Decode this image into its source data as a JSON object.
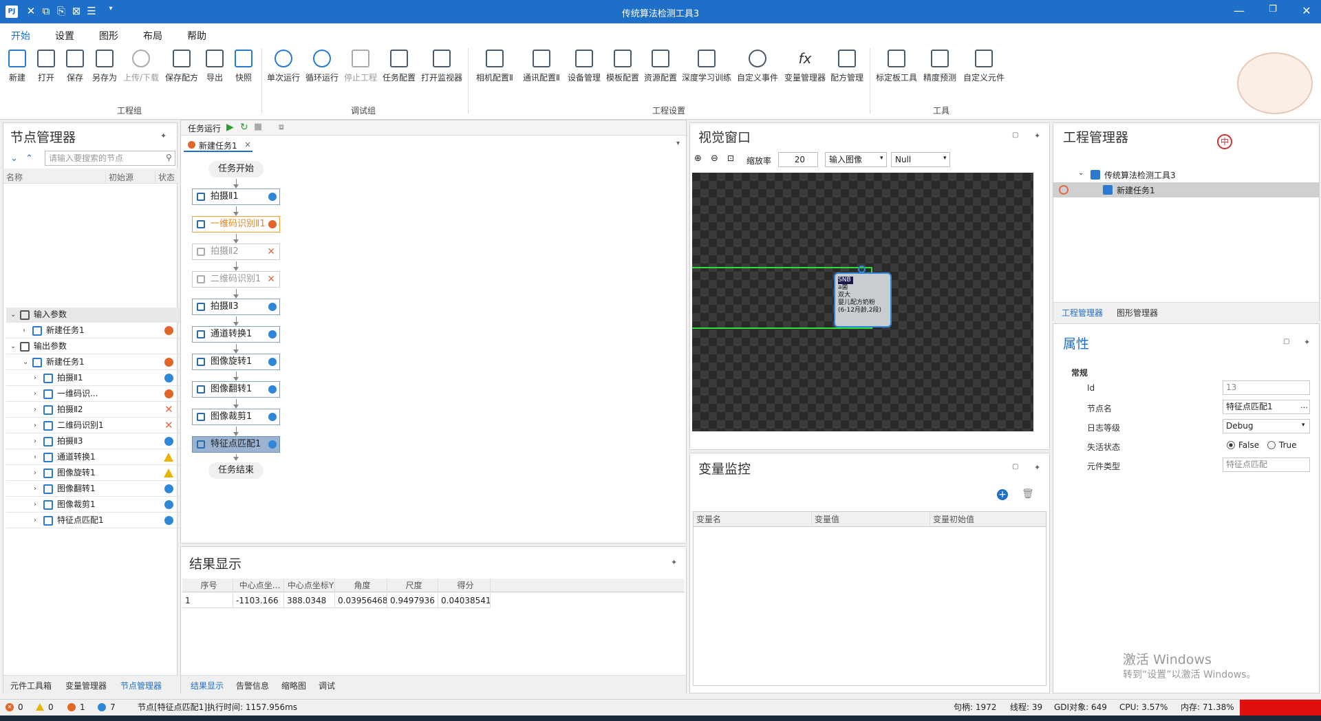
{
  "window": {
    "title": "传统算法检测工具3",
    "app_icon": "PJ"
  },
  "menu": {
    "items": [
      "开始",
      "设置",
      "图形",
      "布局",
      "帮助"
    ]
  },
  "ribbon": {
    "file_buttons": [
      "新建",
      "打开",
      "保存",
      "另存为",
      "上传/下载",
      "保存配方",
      "导出",
      "快照"
    ],
    "file_group": "工程组",
    "debug_buttons": [
      "单次运行",
      "循环运行",
      "停止工程",
      "任务配置",
      "打开监视器"
    ],
    "debug_group": "调试组",
    "settings_buttons": [
      "相机配置Ⅱ",
      "通讯配置Ⅱ",
      "设备管理",
      "模板配置",
      "资源配置",
      "深度学习训练",
      "自定义事件",
      "变量管理器",
      "配方管理"
    ],
    "settings_group": "工程设置",
    "tool_buttons": [
      "标定板工具",
      "精度预测",
      "自定义元件"
    ],
    "tool_group": "工具"
  },
  "node_manager": {
    "title": "节点管理器",
    "search_placeholder": "请输入要搜索的节点",
    "columns": [
      "名称",
      "初始源",
      "状态"
    ],
    "rows": [
      {
        "label": "输入参数",
        "level": 0,
        "group": true,
        "status": ""
      },
      {
        "label": "新建任务1",
        "level": 1,
        "status": "orange"
      },
      {
        "label": "输出参数",
        "level": 0,
        "group": false,
        "status": ""
      },
      {
        "label": "新建任务1",
        "level": 1,
        "status": "orange"
      },
      {
        "label": "拍摄Ⅱ1",
        "level": 2,
        "status": "blue"
      },
      {
        "label": "一维码识...",
        "level": 2,
        "status": "orange"
      },
      {
        "label": "拍摄Ⅱ2",
        "level": 2,
        "status": "x"
      },
      {
        "label": "二维码识别1",
        "level": 2,
        "status": "x"
      },
      {
        "label": "拍摄Ⅱ3",
        "level": 2,
        "status": "blue"
      },
      {
        "label": "通道转换1",
        "level": 2,
        "status": "warn"
      },
      {
        "label": "图像旋转1",
        "level": 2,
        "status": "warn"
      },
      {
        "label": "图像翻转1",
        "level": 2,
        "status": "blue"
      },
      {
        "label": "图像裁剪1",
        "level": 2,
        "status": "blue"
      },
      {
        "label": "特征点匹配1",
        "level": 2,
        "status": "blue"
      }
    ],
    "bottom_tabs": [
      "元件工具箱",
      "变量管理器",
      "节点管理器"
    ]
  },
  "task": {
    "run_label": "任务运行",
    "tab_name": "新建任务1",
    "start": "任务开始",
    "end": "任务结束",
    "nodes": [
      {
        "label": "拍摄Ⅱ1",
        "state": "normal",
        "dot": "blue"
      },
      {
        "label": "一维码识别Ⅱ1",
        "state": "warnb",
        "dot": "orange"
      },
      {
        "label": "拍摄Ⅱ2",
        "state": "disabled",
        "dot": "x"
      },
      {
        "label": "二维码识别1",
        "state": "disabled",
        "dot": "x"
      },
      {
        "label": "拍摄Ⅱ3",
        "state": "normal",
        "dot": "blue"
      },
      {
        "label": "通道转换1",
        "state": "normal",
        "dot": "blue"
      },
      {
        "label": "图像旋转1",
        "state": "normal",
        "dot": "blue"
      },
      {
        "label": "图像翻转1",
        "state": "normal",
        "dot": "blue"
      },
      {
        "label": "图像裁剪1",
        "state": "normal",
        "dot": "blue"
      },
      {
        "label": "特征点匹配1",
        "state": "active",
        "dot": "blue"
      }
    ]
  },
  "results": {
    "title": "结果显示",
    "columns": [
      "序号",
      "中心点坐...",
      "中心点坐标Y",
      "角度",
      "尺度",
      "得分"
    ],
    "rows": [
      [
        "1",
        "-1103.166",
        "388.0348",
        "0.03956468",
        "0.9497936",
        "0.04038541"
      ]
    ],
    "tabs": [
      "结果显示",
      "告警信息",
      "缩略图",
      "调试"
    ]
  },
  "vision": {
    "title": "视觉窗口",
    "zoom_label": "缩放率",
    "zoom_value": "20",
    "source": "输入图像",
    "overlay": "Null",
    "can_text": [
      "SNB",
      "a菌",
      "双大",
      "婴儿配方奶粉",
      "(6-12月龄,2段)"
    ]
  },
  "variables": {
    "title": "变量监控",
    "columns": [
      "变量名",
      "变量值",
      "变量初始值"
    ]
  },
  "project": {
    "title": "工程管理器",
    "root": "传统算法检测工具3",
    "child": "新建任务1",
    "tabs": [
      "工程管理器",
      "图形管理器"
    ],
    "badge": "中"
  },
  "properties": {
    "title": "属性",
    "section": "常规",
    "labels": [
      "Id",
      "节点名",
      "日志等级",
      "失活状态",
      "元件类型"
    ],
    "id_value": "13",
    "node_name": "特征点匹配1",
    "log_level": "Debug",
    "false_label": "False",
    "true_label": "True",
    "type_value": "特征点匹配",
    "activation_line1": "激活 Windows",
    "activation_line2": "转到“设置”以激活 Windows。"
  },
  "status": {
    "err_count": "0",
    "warn_count": "0",
    "orange_count": "1",
    "blue_count": "7",
    "message": "节点[特征点匹配1]执行时间: 1157.956ms",
    "handles": "句柄: 1972",
    "threads": "线程: 39",
    "gdi": "GDI对象: 649",
    "cpu": "CPU: 3.57%",
    "mem": "内存: 71.38%"
  },
  "colors": {
    "accent": "#1e6fc7",
    "blue_dot": "#2f87d8",
    "orange_dot": "#e0662a",
    "warn": "#e8b400"
  }
}
